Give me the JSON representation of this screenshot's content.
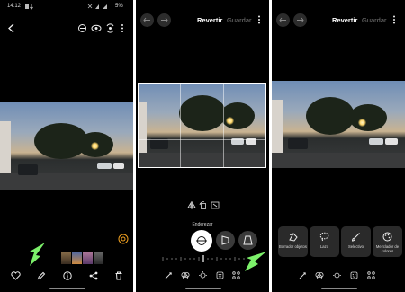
{
  "status_bar": {
    "time": "14:12",
    "battery": "5%"
  },
  "editor": {
    "revert_label": "Revertir",
    "save_label": "Guardar"
  },
  "straighten": {
    "label": "Enderezar"
  },
  "tools": [
    {
      "label": "Borrador objetos",
      "icon": "eraser-icon"
    },
    {
      "label": "Lazo",
      "icon": "lasso-icon"
    },
    {
      "label": "Selectivo",
      "icon": "brush-icon"
    },
    {
      "label": "Mezclador de colores",
      "icon": "palette-icon"
    }
  ],
  "colors": {
    "background": "#000000",
    "highlight_arrow": "#7cf06a",
    "card": "#2a2a2a"
  }
}
